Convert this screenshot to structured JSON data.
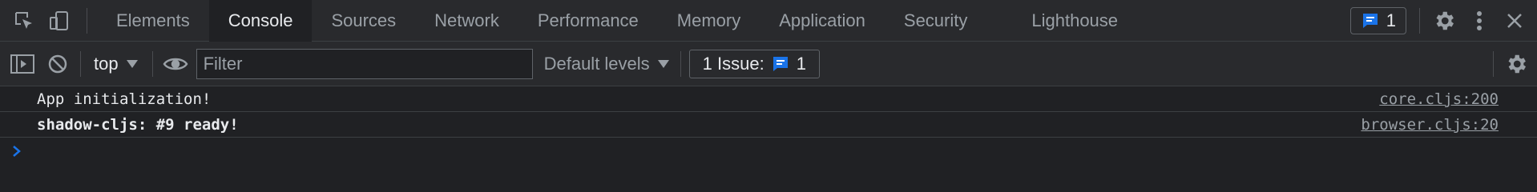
{
  "colors": {
    "accent": "#1a73e8",
    "link": "#9aa0a6",
    "background": "#202124",
    "toolbar": "#292a2d"
  },
  "toolbar": {
    "tabs": [
      {
        "label": "Elements"
      },
      {
        "label": "Console",
        "active": true
      },
      {
        "label": "Sources"
      },
      {
        "label": "Network"
      },
      {
        "label": "Performance"
      },
      {
        "label": "Memory"
      },
      {
        "label": "Application"
      },
      {
        "label": "Security"
      },
      {
        "label": "Lighthouse"
      }
    ],
    "issues_count": "1"
  },
  "console_toolbar": {
    "context": "top",
    "filter_placeholder": "Filter",
    "levels": "Default levels",
    "issues_label": "1 Issue:",
    "issues_count": "1"
  },
  "messages": [
    {
      "text": "App initialization!",
      "source": "core.cljs:200",
      "bold": false
    },
    {
      "text": "shadow-cljs: #9 ready!",
      "source": "browser.cljs:20",
      "bold": true
    }
  ]
}
